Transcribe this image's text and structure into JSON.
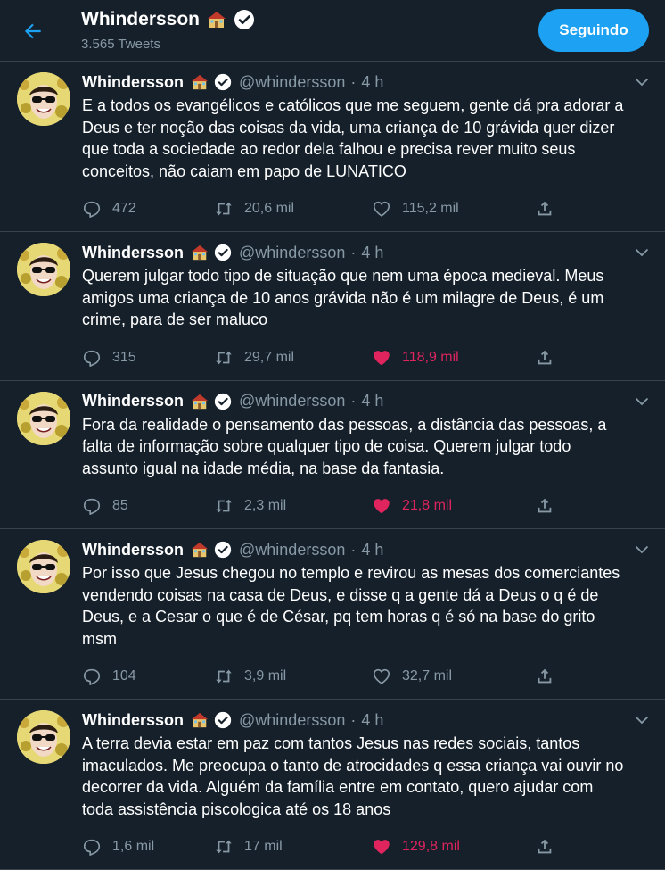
{
  "header": {
    "name": "Whindersson",
    "tweet_count": "3.565 Tweets",
    "follow_label": "Seguindo"
  },
  "colors": {
    "accent": "#1da1f2",
    "like": "#e0245e",
    "bg": "#15202b"
  },
  "tweets": [
    {
      "name": "Whindersson",
      "handle": "@whindersson",
      "time": "4 h",
      "lines": [
        "E a todos os evangélicos e católicos que me seguem, gente dá pra adorar a",
        "Deus e ter noção das coisas da vida, uma criança de 10 grávida quer dizer",
        "que toda a sociedade ao redor dela falhou e precisa rever muito seus",
        "conceitos, não caiam em papo de LUNATICO"
      ],
      "replies": "472",
      "retweets": "20,6 mil",
      "likes": "115,2 mil",
      "liked": false
    },
    {
      "name": "Whindersson",
      "handle": "@whindersson",
      "time": "4 h",
      "lines": [
        "Querem julgar todo tipo de situação que nem uma época medieval. Meus",
        "amigos uma criança de 10 anos grávida não é um milagre de Deus, é um",
        "crime, para de ser maluco"
      ],
      "replies": "315",
      "retweets": "29,7 mil",
      "likes": "118,9 mil",
      "liked": true
    },
    {
      "name": "Whindersson",
      "handle": "@whindersson",
      "time": "4 h",
      "lines": [
        "Fora da realidade o pensamento das pessoas, a distância das pessoas, a",
        "falta de informação sobre qualquer tipo de coisa. Querem julgar todo",
        "assunto igual na idade média, na base da fantasia."
      ],
      "replies": "85",
      "retweets": "2,3 mil",
      "likes": "21,8 mil",
      "liked": true
    },
    {
      "name": "Whindersson",
      "handle": "@whindersson",
      "time": "4 h",
      "lines": [
        "Por isso que Jesus chegou no templo e revirou as mesas dos comerciantes",
        "vendendo coisas na casa de Deus, e disse q a gente dá a Deus o q é de",
        "Deus, e a Cesar o que é de César, pq tem horas q é só na base do grito",
        "msm"
      ],
      "replies": "104",
      "retweets": "3,9 mil",
      "likes": "32,7 mil",
      "liked": false
    },
    {
      "name": "Whindersson",
      "handle": "@whindersson",
      "time": "4 h",
      "lines": [
        "A terra devia estar em paz com tantos Jesus nas redes sociais, tantos",
        "imaculados. Me preocupa o tanto de atrocidades q essa criança vai ouvir no",
        "decorrer da vida. Alguém da família entre em contato, quero ajudar com",
        "toda assistência piscologica até os 18 anos"
      ],
      "replies": "1,6 mil",
      "retweets": "17 mil",
      "likes": "129,8 mil",
      "liked": true
    }
  ]
}
